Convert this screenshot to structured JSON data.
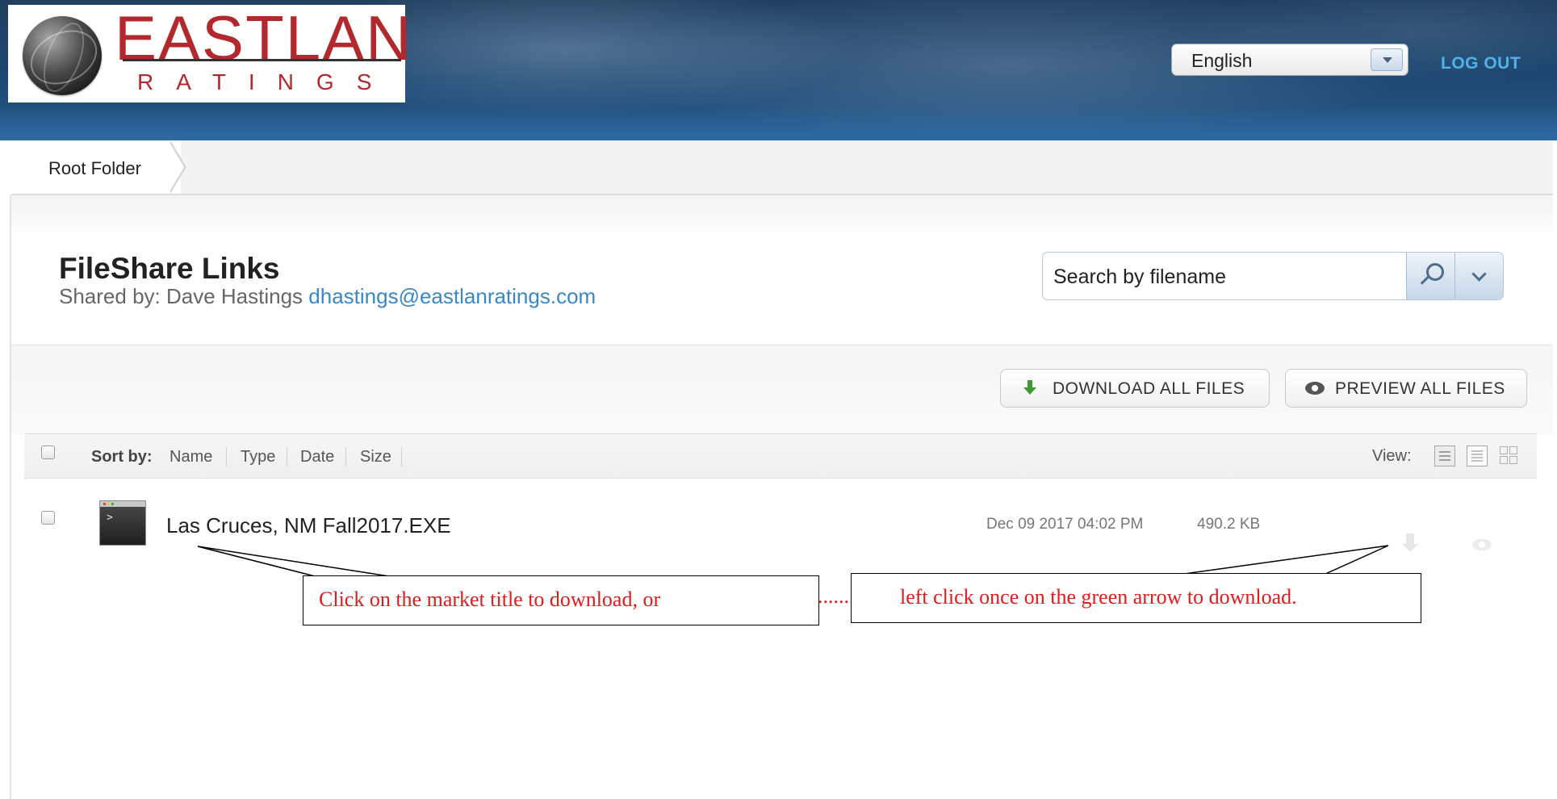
{
  "header": {
    "logo": {
      "word": "EASTLAN",
      "sub": "RATINGS"
    },
    "language": {
      "selected": "English"
    },
    "logout_label": "LOG OUT"
  },
  "breadcrumb": {
    "root_label": "Root Folder"
  },
  "page": {
    "title": "FileShare Links",
    "shared_by_prefix": "Shared by: Dave Hastings",
    "shared_by_email": "dhastings@eastlanratings.com"
  },
  "search": {
    "placeholder": "Search by filename"
  },
  "actions": {
    "download_all": "DOWNLOAD ALL FILES",
    "preview_all": "PREVIEW ALL FILES"
  },
  "sortbar": {
    "label": "Sort by:",
    "options": [
      "Name",
      "Type",
      "Date",
      "Size"
    ],
    "view_label": "View:"
  },
  "files": [
    {
      "name": "Las Cruces, NM Fall2017.EXE",
      "date": "Dec 09 2017 04:02 PM",
      "size": "490.2 KB"
    }
  ],
  "annotations": {
    "left": "Click on the market title to download, or",
    "dots": "......................",
    "right": "left click once on the green arrow to download."
  },
  "colors": {
    "header_blue": "#1d4872",
    "logo_red": "#b3282c",
    "logout_link": "#4fb2ea",
    "email_link": "#3a87c5",
    "download_green": "#3d9b2e",
    "annotation_red": "#e01b1b"
  }
}
